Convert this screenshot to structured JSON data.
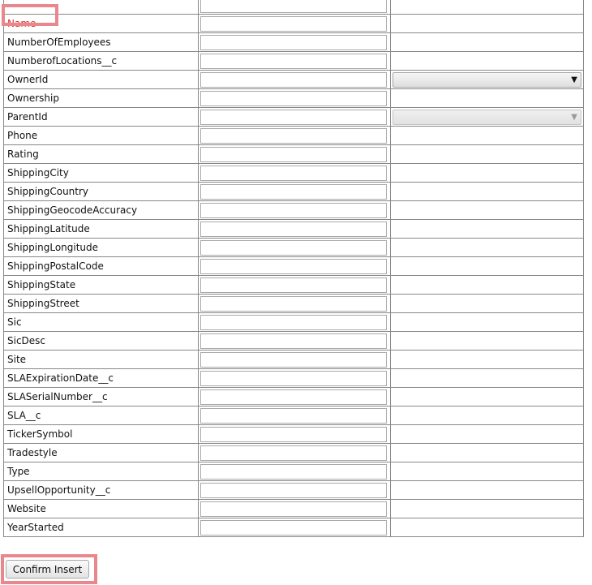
{
  "form": {
    "rows": [
      {
        "label": "",
        "control": "none"
      },
      {
        "label": "Name",
        "required": true,
        "control": "none"
      },
      {
        "label": "NumberOfEmployees",
        "control": "none"
      },
      {
        "label": "NumberofLocations__c",
        "control": "none"
      },
      {
        "label": "OwnerId",
        "control": "select"
      },
      {
        "label": "Ownership",
        "control": "none"
      },
      {
        "label": "ParentId",
        "control": "select-disabled"
      },
      {
        "label": "Phone",
        "control": "none"
      },
      {
        "label": "Rating",
        "control": "none"
      },
      {
        "label": "ShippingCity",
        "control": "none"
      },
      {
        "label": "ShippingCountry",
        "control": "none"
      },
      {
        "label": "ShippingGeocodeAccuracy",
        "control": "none"
      },
      {
        "label": "ShippingLatitude",
        "control": "none"
      },
      {
        "label": "ShippingLongitude",
        "control": "none"
      },
      {
        "label": "ShippingPostalCode",
        "control": "none"
      },
      {
        "label": "ShippingState",
        "control": "none"
      },
      {
        "label": "ShippingStreet",
        "control": "none"
      },
      {
        "label": "Sic",
        "control": "none"
      },
      {
        "label": "SicDesc",
        "control": "none"
      },
      {
        "label": "Site",
        "control": "none"
      },
      {
        "label": "SLAExpirationDate__c",
        "control": "none"
      },
      {
        "label": "SLASerialNumber__c",
        "control": "none"
      },
      {
        "label": "SLA__c",
        "control": "none"
      },
      {
        "label": "TickerSymbol",
        "control": "none"
      },
      {
        "label": "Tradestyle",
        "control": "none"
      },
      {
        "label": "Type",
        "control": "none"
      },
      {
        "label": "UpsellOpportunity__c",
        "control": "none"
      },
      {
        "label": "Website",
        "control": "none"
      },
      {
        "label": "YearStarted",
        "control": "none"
      }
    ]
  },
  "confirm_button": {
    "label": "Confirm Insert"
  },
  "icons": {
    "dropdown_arrow": "▼"
  },
  "colors": {
    "required_label": "#d9342b",
    "highlight": "#e8878c",
    "cell_border": "#888888"
  }
}
